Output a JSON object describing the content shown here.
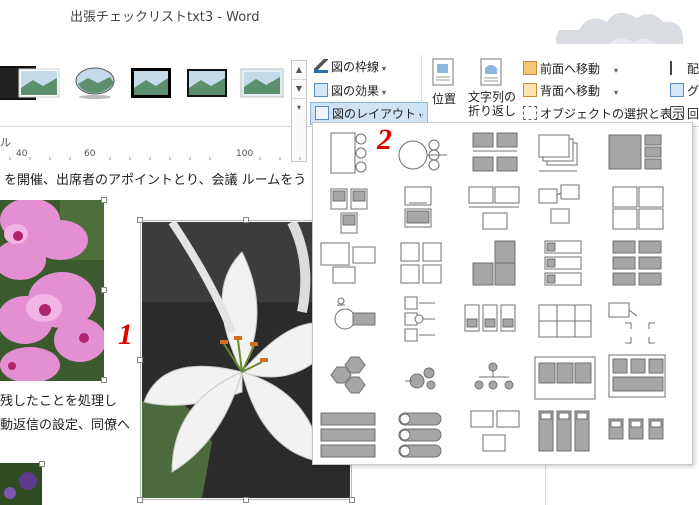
{
  "window": {
    "title": "出張チェックリストtxt3 - Word"
  },
  "ribbon": {
    "picture_border": "図の枠線",
    "picture_effects": "図の効果",
    "picture_layout": "図のレイアウト",
    "position": "位置",
    "wrap_text_line1": "文字列の",
    "wrap_text_line2": "折り返し",
    "bring_forward": "前面へ移動",
    "send_backward": "背面へ移動",
    "selection_pane": "オブジェクトの選択と表示",
    "align_partial": "配",
    "group_partial": "グ",
    "rotate_partial": "回",
    "group_label_partial": "ル"
  },
  "ruler": {
    "ticks": [
      "40",
      "60",
      "100"
    ]
  },
  "document": {
    "line1": "を開催、出席者のアポイントとり、会議 ルームをう",
    "line2": "残したことを処理し",
    "line3": "動返信の設定、同僚へ"
  },
  "annotations": {
    "one": "1",
    "two": "2"
  },
  "gallery": {
    "layout_count": 35
  },
  "colors": {
    "accent_red": "#e00000",
    "thumb_gray": "#a6a6a6"
  }
}
